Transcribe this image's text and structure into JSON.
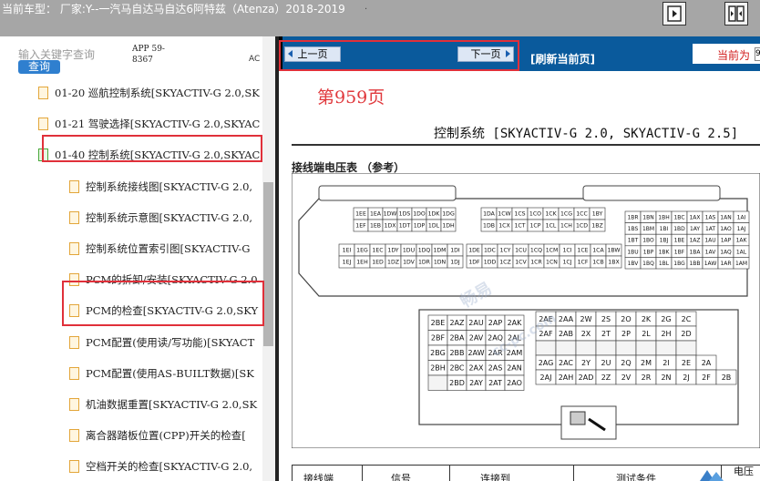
{
  "header": {
    "vehicle_label": "当前车型：  厂家:Y--一汽马自达马自达6阿特兹（Atenza）2018-2019",
    "dot": "."
  },
  "search": {
    "placeholder": "输入关键字查询",
    "button": "查询"
  },
  "left_meta": {
    "app_code": "APP 59-8367",
    "col_tag": "AC"
  },
  "tree": [
    {
      "label": "01-20 巡航控制系统[SKYACTIV-G 2.0,SK",
      "level": 0,
      "color": "orange"
    },
    {
      "label": "01-21 驾驶选择[SKYACTIV-G 2.0,SKYAC",
      "level": 0,
      "color": "orange"
    },
    {
      "label": "01-40 控制系统[SKYACTIV-G 2.0,SKYAC",
      "level": 0,
      "color": "green"
    },
    {
      "label": "控制系统接线图[SKYACTIV-G 2.0,",
      "level": 1,
      "color": "orange"
    },
    {
      "label": "控制系统示意图[SKYACTIV-G 2.0,",
      "level": 1,
      "color": "orange"
    },
    {
      "label": "控制系统位置索引图[SKYACTIV-G",
      "level": 1,
      "color": "orange"
    },
    {
      "label": "PCM的拆卸/安装[SKYACTIV-G 2.0",
      "level": 1,
      "color": "orange"
    },
    {
      "label": "PCM的检查[SKYACTIV-G 2.0,SKY",
      "level": 1,
      "color": "orange"
    },
    {
      "label": "PCM配置(使用读/写功能)[SKYACT",
      "level": 1,
      "color": "orange"
    },
    {
      "label": "PCM配置(使用AS-BUILT数据)[SK",
      "level": 1,
      "color": "orange"
    },
    {
      "label": "机油数据重置[SKYACTIV-G 2.0,SK",
      "level": 1,
      "color": "orange"
    },
    {
      "label": "离合器踏板位置(CPP)开关的检查[",
      "level": 1,
      "color": "orange"
    },
    {
      "label": "空档开关的检查[SKYACTIV-G 2.0,",
      "level": 1,
      "color": "orange"
    }
  ],
  "nav": {
    "prev": "上一页",
    "next": "下一页",
    "refresh": "[刷新当前页]",
    "current": "当前为",
    "page_box": "9"
  },
  "document": {
    "page_label": "第959页",
    "title": "控制系统 [SKYACTIV-G 2.0, SKYACTIV-G 2.5]",
    "section": "接线端电压表 （参考）",
    "connector_upper": {
      "block_a": [
        [
          "1EE",
          "1EA",
          "1DW",
          "1DS",
          "1DO",
          "1DK",
          "1DG"
        ],
        [
          "1EF",
          "1EB",
          "1DX",
          "1DT",
          "1DP",
          "1DL",
          "1DH"
        ]
      ],
      "block_b": [
        [
          "1DA",
          "1CW",
          "1CS",
          "1CO",
          "1CK",
          "1CG",
          "1CC",
          "1BY"
        ],
        [
          "1DB",
          "1CX",
          "1CT",
          "1CP",
          "1CL",
          "1CH",
          "1CD",
          "1BZ"
        ]
      ],
      "block_c": [
        [
          "1EI",
          "1EG",
          "1EC",
          "1DY",
          "1DU",
          "1DQ",
          "1DM",
          "1DI"
        ],
        [
          "1EJ",
          "1EH",
          "1ED",
          "1DZ",
          "1DV",
          "1DR",
          "1DN",
          "1DJ"
        ]
      ],
      "block_d": [
        [
          "1DE",
          "1DC",
          "1CY",
          "1CU",
          "1CQ",
          "1CM",
          "1CI",
          "1CE",
          "1CA",
          "1BW"
        ],
        [
          "1DF",
          "1DD",
          "1CZ",
          "1CV",
          "1CR",
          "1CN",
          "1CJ",
          "1CF",
          "1CB",
          "1BX"
        ]
      ],
      "block_e": [
        [
          "1BR",
          "1BN",
          "1BH",
          "1BC",
          "1AX",
          "1AS",
          "1AN",
          "1AI"
        ],
        [
          "1BS",
          "1BM",
          "1BI",
          "1BD",
          "1AY",
          "1AT",
          "1AO",
          "1AJ"
        ],
        [
          "1BT",
          "1BO",
          "1BJ",
          "1BE",
          "1AZ",
          "1AU",
          "1AP",
          "1AK"
        ],
        [
          "1BU",
          "1BP",
          "1BK",
          "1BF",
          "1BA",
          "1AV",
          "1AQ",
          "1AL"
        ],
        [
          "1BV",
          "1BQ",
          "1BL",
          "1BG",
          "1BB",
          "1AW",
          "1AR",
          "1AM"
        ]
      ]
    },
    "connector_lower": {
      "left": [
        [
          "2BE",
          "2AZ",
          "2AU",
          "2AP",
          "2AK"
        ],
        [
          "2BF",
          "2BA",
          "2AV",
          "2AQ",
          "2AL"
        ],
        [
          "2BG",
          "2BB",
          "2AW",
          "2AR",
          "2AM"
        ],
        [
          "2BH",
          "2BC",
          "2AX",
          "2AS",
          "2AN"
        ],
        [
          "",
          "2BD",
          "2AY",
          "2AT",
          "2AO"
        ]
      ],
      "right": [
        [
          "2AE",
          "2AA",
          "2W",
          "2S",
          "2O",
          "2K",
          "2G",
          "2C"
        ],
        [
          "2AF",
          "2AB",
          "2X",
          "2T",
          "2P",
          "2L",
          "2H",
          "2D"
        ],
        [
          "",
          "",
          "",
          "",
          "",
          "",
          "",
          ""
        ],
        [
          "2AG",
          "2AC",
          "2Y",
          "2U",
          "2Q",
          "2M",
          "2I",
          "2E",
          "2A"
        ],
        [
          "2AJ",
          "2AH",
          "2AD",
          "2Z",
          "2V",
          "2R",
          "2N",
          "2J",
          "2F",
          "2B"
        ]
      ]
    },
    "table_headers": [
      "接线端",
      "信号",
      "连接到",
      "测试条件",
      "电压"
    ]
  },
  "watermarks": [
    "畅易",
    "cc-pc.com"
  ],
  "colors": {
    "nav_blue": "#0a5a9c",
    "highlight_red": "#e0303a",
    "page_red": "#e0383c",
    "query_blue": "#2f7fcf"
  }
}
